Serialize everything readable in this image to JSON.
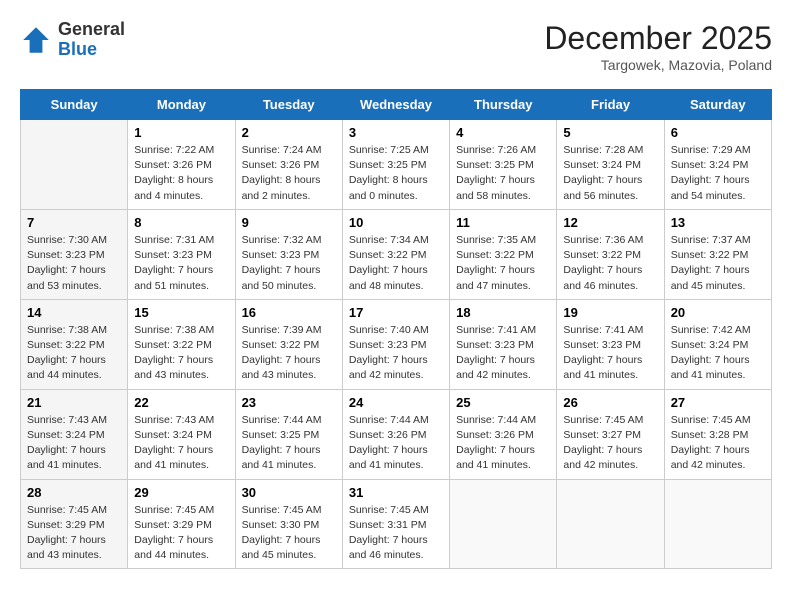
{
  "logo": {
    "general": "General",
    "blue": "Blue"
  },
  "title": "December 2025",
  "location": "Targowek, Mazovia, Poland",
  "days_of_week": [
    "Sunday",
    "Monday",
    "Tuesday",
    "Wednesday",
    "Thursday",
    "Friday",
    "Saturday"
  ],
  "weeks": [
    [
      {
        "day": "",
        "sunrise": "",
        "sunset": "",
        "daylight": ""
      },
      {
        "day": "1",
        "sunrise": "Sunrise: 7:22 AM",
        "sunset": "Sunset: 3:26 PM",
        "daylight": "Daylight: 8 hours and 4 minutes."
      },
      {
        "day": "2",
        "sunrise": "Sunrise: 7:24 AM",
        "sunset": "Sunset: 3:26 PM",
        "daylight": "Daylight: 8 hours and 2 minutes."
      },
      {
        "day": "3",
        "sunrise": "Sunrise: 7:25 AM",
        "sunset": "Sunset: 3:25 PM",
        "daylight": "Daylight: 8 hours and 0 minutes."
      },
      {
        "day": "4",
        "sunrise": "Sunrise: 7:26 AM",
        "sunset": "Sunset: 3:25 PM",
        "daylight": "Daylight: 7 hours and 58 minutes."
      },
      {
        "day": "5",
        "sunrise": "Sunrise: 7:28 AM",
        "sunset": "Sunset: 3:24 PM",
        "daylight": "Daylight: 7 hours and 56 minutes."
      },
      {
        "day": "6",
        "sunrise": "Sunrise: 7:29 AM",
        "sunset": "Sunset: 3:24 PM",
        "daylight": "Daylight: 7 hours and 54 minutes."
      }
    ],
    [
      {
        "day": "7",
        "sunrise": "Sunrise: 7:30 AM",
        "sunset": "Sunset: 3:23 PM",
        "daylight": "Daylight: 7 hours and 53 minutes."
      },
      {
        "day": "8",
        "sunrise": "Sunrise: 7:31 AM",
        "sunset": "Sunset: 3:23 PM",
        "daylight": "Daylight: 7 hours and 51 minutes."
      },
      {
        "day": "9",
        "sunrise": "Sunrise: 7:32 AM",
        "sunset": "Sunset: 3:23 PM",
        "daylight": "Daylight: 7 hours and 50 minutes."
      },
      {
        "day": "10",
        "sunrise": "Sunrise: 7:34 AM",
        "sunset": "Sunset: 3:22 PM",
        "daylight": "Daylight: 7 hours and 48 minutes."
      },
      {
        "day": "11",
        "sunrise": "Sunrise: 7:35 AM",
        "sunset": "Sunset: 3:22 PM",
        "daylight": "Daylight: 7 hours and 47 minutes."
      },
      {
        "day": "12",
        "sunrise": "Sunrise: 7:36 AM",
        "sunset": "Sunset: 3:22 PM",
        "daylight": "Daylight: 7 hours and 46 minutes."
      },
      {
        "day": "13",
        "sunrise": "Sunrise: 7:37 AM",
        "sunset": "Sunset: 3:22 PM",
        "daylight": "Daylight: 7 hours and 45 minutes."
      }
    ],
    [
      {
        "day": "14",
        "sunrise": "Sunrise: 7:38 AM",
        "sunset": "Sunset: 3:22 PM",
        "daylight": "Daylight: 7 hours and 44 minutes."
      },
      {
        "day": "15",
        "sunrise": "Sunrise: 7:38 AM",
        "sunset": "Sunset: 3:22 PM",
        "daylight": "Daylight: 7 hours and 43 minutes."
      },
      {
        "day": "16",
        "sunrise": "Sunrise: 7:39 AM",
        "sunset": "Sunset: 3:22 PM",
        "daylight": "Daylight: 7 hours and 43 minutes."
      },
      {
        "day": "17",
        "sunrise": "Sunrise: 7:40 AM",
        "sunset": "Sunset: 3:23 PM",
        "daylight": "Daylight: 7 hours and 42 minutes."
      },
      {
        "day": "18",
        "sunrise": "Sunrise: 7:41 AM",
        "sunset": "Sunset: 3:23 PM",
        "daylight": "Daylight: 7 hours and 42 minutes."
      },
      {
        "day": "19",
        "sunrise": "Sunrise: 7:41 AM",
        "sunset": "Sunset: 3:23 PM",
        "daylight": "Daylight: 7 hours and 41 minutes."
      },
      {
        "day": "20",
        "sunrise": "Sunrise: 7:42 AM",
        "sunset": "Sunset: 3:24 PM",
        "daylight": "Daylight: 7 hours and 41 minutes."
      }
    ],
    [
      {
        "day": "21",
        "sunrise": "Sunrise: 7:43 AM",
        "sunset": "Sunset: 3:24 PM",
        "daylight": "Daylight: 7 hours and 41 minutes."
      },
      {
        "day": "22",
        "sunrise": "Sunrise: 7:43 AM",
        "sunset": "Sunset: 3:24 PM",
        "daylight": "Daylight: 7 hours and 41 minutes."
      },
      {
        "day": "23",
        "sunrise": "Sunrise: 7:44 AM",
        "sunset": "Sunset: 3:25 PM",
        "daylight": "Daylight: 7 hours and 41 minutes."
      },
      {
        "day": "24",
        "sunrise": "Sunrise: 7:44 AM",
        "sunset": "Sunset: 3:26 PM",
        "daylight": "Daylight: 7 hours and 41 minutes."
      },
      {
        "day": "25",
        "sunrise": "Sunrise: 7:44 AM",
        "sunset": "Sunset: 3:26 PM",
        "daylight": "Daylight: 7 hours and 41 minutes."
      },
      {
        "day": "26",
        "sunrise": "Sunrise: 7:45 AM",
        "sunset": "Sunset: 3:27 PM",
        "daylight": "Daylight: 7 hours and 42 minutes."
      },
      {
        "day": "27",
        "sunrise": "Sunrise: 7:45 AM",
        "sunset": "Sunset: 3:28 PM",
        "daylight": "Daylight: 7 hours and 42 minutes."
      }
    ],
    [
      {
        "day": "28",
        "sunrise": "Sunrise: 7:45 AM",
        "sunset": "Sunset: 3:29 PM",
        "daylight": "Daylight: 7 hours and 43 minutes."
      },
      {
        "day": "29",
        "sunrise": "Sunrise: 7:45 AM",
        "sunset": "Sunset: 3:29 PM",
        "daylight": "Daylight: 7 hours and 44 minutes."
      },
      {
        "day": "30",
        "sunrise": "Sunrise: 7:45 AM",
        "sunset": "Sunset: 3:30 PM",
        "daylight": "Daylight: 7 hours and 45 minutes."
      },
      {
        "day": "31",
        "sunrise": "Sunrise: 7:45 AM",
        "sunset": "Sunset: 3:31 PM",
        "daylight": "Daylight: 7 hours and 46 minutes."
      },
      {
        "day": "",
        "sunrise": "",
        "sunset": "",
        "daylight": ""
      },
      {
        "day": "",
        "sunrise": "",
        "sunset": "",
        "daylight": ""
      },
      {
        "day": "",
        "sunrise": "",
        "sunset": "",
        "daylight": ""
      }
    ]
  ]
}
